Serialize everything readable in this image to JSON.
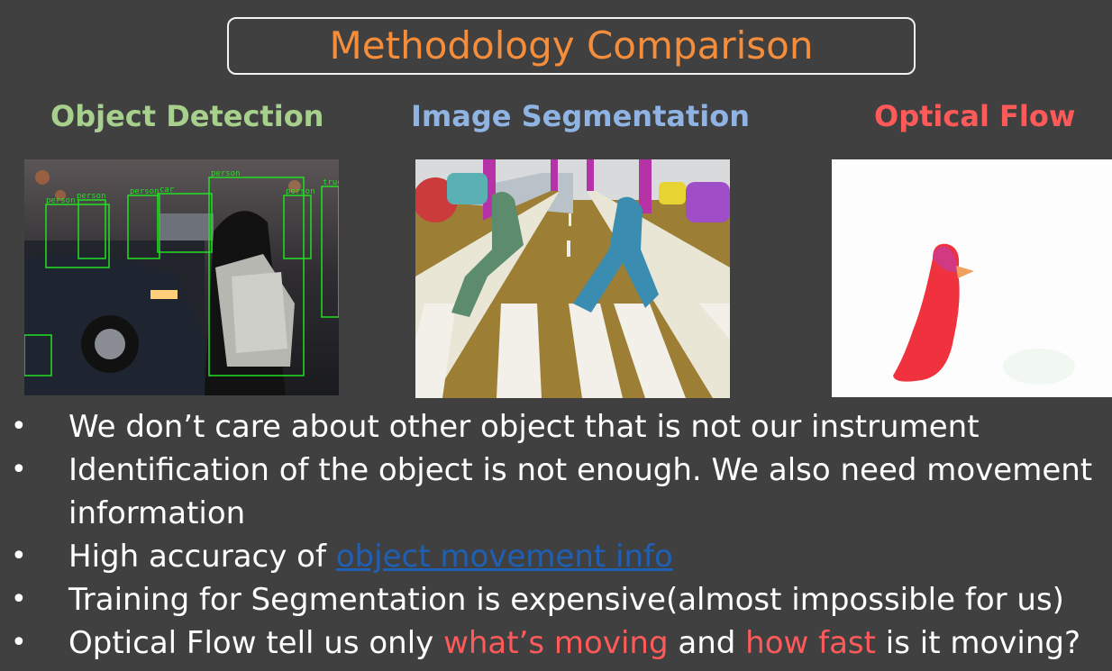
{
  "slide": {
    "title": "Methodology Comparison",
    "columns": [
      {
        "heading": "Object Detection",
        "color": "#a8d08d"
      },
      {
        "heading": "Image Segmentation",
        "color": "#8fb4e3"
      },
      {
        "heading": "Optical Flow",
        "color": "#ff5a5a"
      }
    ],
    "detection_labels": [
      "person",
      "person",
      "person",
      "person",
      "car",
      "person",
      "truck"
    ],
    "bullets": {
      "b1": "We don’t care about other object that is not our instrument",
      "b2": "Identification of the object is not enough. We also need movement information",
      "b3_prefix": "High accuracy of ",
      "b3_link": "object movement info",
      "b4": "Training for Segmentation is expensive(almost impossible for us)",
      "b5_a": "Optical Flow tell us only ",
      "b5_h1": "what’s moving",
      "b5_b": " and ",
      "b5_h2": "how fast",
      "b5_c": " is it moving?"
    },
    "bullet_symbol": "•",
    "colors": {
      "background": "#404040",
      "title": "#f58d3b",
      "link": "#1f5fb4",
      "highlight": "#ff5a5a",
      "text": "#ffffff"
    }
  }
}
